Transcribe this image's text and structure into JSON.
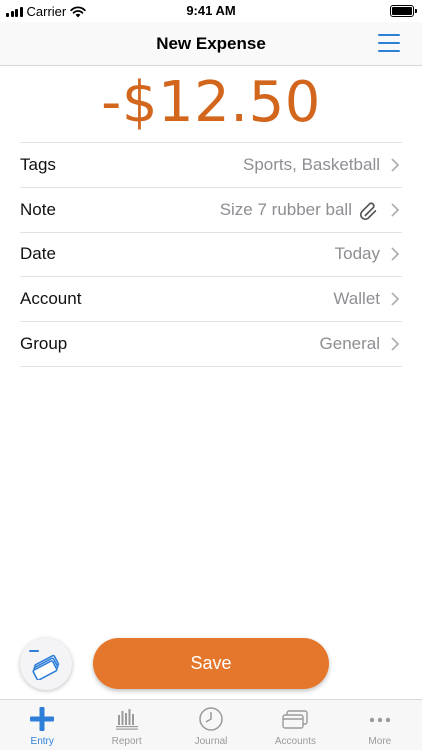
{
  "status": {
    "carrier": "Carrier",
    "time": "9:41 AM"
  },
  "nav": {
    "title": "New Expense",
    "menu_icon": "hamburger-menu-icon"
  },
  "amount": "-$12.50",
  "fields": [
    {
      "label": "Tags",
      "value": "Sports, Basketball"
    },
    {
      "label": "Note",
      "value": "Size 7 rubber ball"
    },
    {
      "label": "Date",
      "value": "Today"
    },
    {
      "label": "Account",
      "value": "Wallet"
    },
    {
      "label": "Group",
      "value": "General"
    }
  ],
  "save_label": "Save",
  "tabs": [
    {
      "label": "Entry",
      "icon": "plus-icon",
      "active": true
    },
    {
      "label": "Report",
      "icon": "bar-report-icon"
    },
    {
      "label": "Journal",
      "icon": "clock-icon"
    },
    {
      "label": "Accounts",
      "icon": "cards-icon"
    },
    {
      "label": "More",
      "icon": "ellipsis-icon"
    }
  ],
  "colors": {
    "accent": "#2e7fd8",
    "amount": "#d2661d",
    "save": "#e5772c",
    "secondary_text": "#8e8e93"
  }
}
